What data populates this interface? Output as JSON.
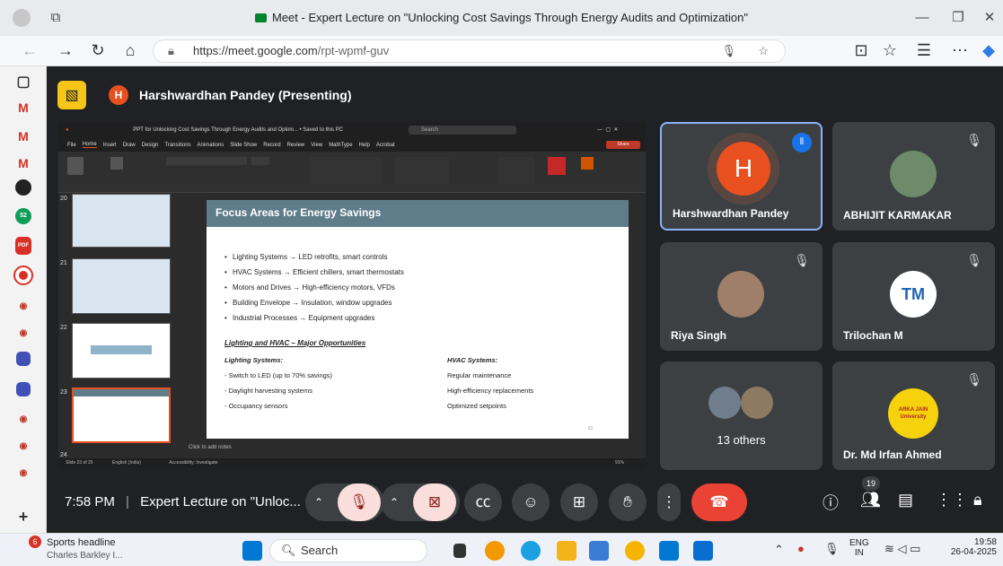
{
  "browser": {
    "title": "Meet - Expert Lecture on \"Unlocking Cost Savings Through Energy Audits and Optimization\"",
    "url_host": "https://meet.google.com",
    "url_path": "/rpt-wpmf-guv"
  },
  "presenter": {
    "initial": "H",
    "label": "Harshwardhan Pandey (Presenting)"
  },
  "ppt": {
    "window_title": "PPT for Unlocking Cost Savings Through Energy Audits and Optimi... • Saved to this PC",
    "search_placeholder": "Search",
    "menu": [
      "File",
      "Home",
      "Insert",
      "Draw",
      "Design",
      "Transitions",
      "Animations",
      "Slide Show",
      "Record",
      "Review",
      "View",
      "MathType",
      "Help",
      "Acrobat"
    ],
    "share_label": "Share",
    "thumb_numbers": [
      "20",
      "21",
      "22",
      "23",
      "24"
    ],
    "notes_placeholder": "Click to add notes",
    "status_left": "Slide 23 of 25",
    "status_lang": "English (India)",
    "status_access": "Accessibility: Investigate",
    "zoom": "91%"
  },
  "slide": {
    "title": "Focus Areas for Energy Savings",
    "bullets": [
      "Lighting Systems → LED retrofits, smart controls",
      "HVAC Systems → Efficient chillers, smart thermostats",
      "Motors and Drives → High-efficiency motors, VFDs",
      "Building Envelope → Insulation, window upgrades",
      "Industrial Processes → Equipment upgrades"
    ],
    "subheading": "Lighting and HVAC – Major Opportunities",
    "left_col": {
      "heading": "Lighting Systems:",
      "items": [
        "- Switch to LED (up to 70% savings)",
        "- Daylight harvesting systems",
        "- Occupancy sensors"
      ]
    },
    "right_col": {
      "heading": "HVAC Systems:",
      "items": [
        "Regular maintenance",
        "High-efficiency replacements",
        "Optimized setpoints"
      ]
    },
    "page_num": "23"
  },
  "participants": [
    {
      "name": "Harshwardhan Pandey",
      "initial": "H",
      "speaking": true
    },
    {
      "name": "ABHIJIT KARMAKAR",
      "muted": true
    },
    {
      "name": "Riya Singh",
      "muted": true
    },
    {
      "name": "Trilochan M",
      "muted": true
    },
    {
      "name": "13 others"
    },
    {
      "name": "Dr. Md Irfan Ahmed",
      "muted": true,
      "logo_text": "ARKA JAIN University"
    }
  ],
  "meeting": {
    "time": "7:58 PM",
    "title": "Expert Lecture on \"Unloc...",
    "people_count": "19"
  },
  "taskbar": {
    "news_title": "Sports headline",
    "news_sub": "Charles Barkley I...",
    "news_badge": "6",
    "search_label": "Search",
    "lang_top": "ENG",
    "lang_bottom": "IN",
    "clock_time": "19:58",
    "clock_date": "26-04-2025"
  },
  "colors": {
    "meet_bg": "#202124",
    "tile_bg": "#3c4043",
    "hangup_red": "#ea4335",
    "muted_pink": "#f9dedc",
    "slide_header": "#5f7c8a",
    "active_border": "#8ab4f8"
  }
}
